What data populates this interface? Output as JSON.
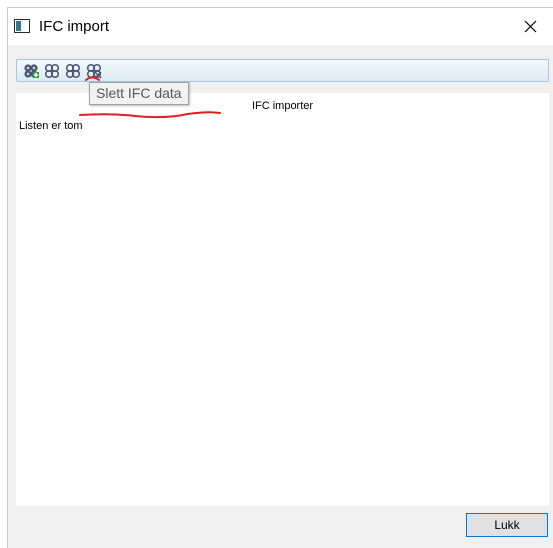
{
  "window": {
    "title": "IFC import"
  },
  "toolbar": {
    "buttons": [
      {
        "icon": "ifc-add-icon",
        "accent": "#2e9e3a"
      },
      {
        "icon": "ifc-model-icon"
      },
      {
        "icon": "ifc-model-icon"
      },
      {
        "icon": "ifc-delete-icon"
      }
    ]
  },
  "tooltip": {
    "text": "Slett IFC data"
  },
  "list": {
    "header": "IFC importer",
    "empty_text": "Listen er tom"
  },
  "footer": {
    "close_label": "Lukk"
  },
  "colors": {
    "annotation": "#e02020",
    "button_focus": "#0078d7",
    "icon": "#4a5470"
  }
}
